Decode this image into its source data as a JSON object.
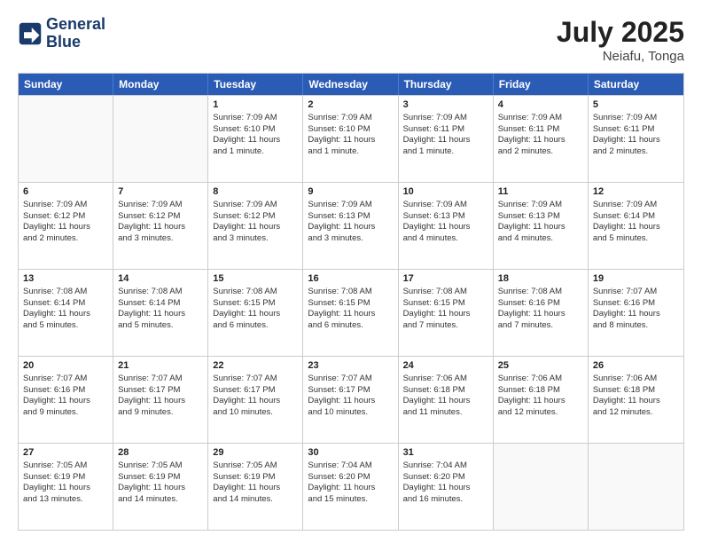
{
  "header": {
    "logo_line1": "General",
    "logo_line2": "Blue",
    "title": "July 2025",
    "subtitle": "Neiafu, Tonga"
  },
  "days": [
    "Sunday",
    "Monday",
    "Tuesday",
    "Wednesday",
    "Thursday",
    "Friday",
    "Saturday"
  ],
  "weeks": [
    [
      {
        "day": "",
        "empty": true
      },
      {
        "day": "",
        "empty": true
      },
      {
        "day": "1",
        "line1": "Sunrise: 7:09 AM",
        "line2": "Sunset: 6:10 PM",
        "line3": "Daylight: 11 hours",
        "line4": "and 1 minute."
      },
      {
        "day": "2",
        "line1": "Sunrise: 7:09 AM",
        "line2": "Sunset: 6:10 PM",
        "line3": "Daylight: 11 hours",
        "line4": "and 1 minute."
      },
      {
        "day": "3",
        "line1": "Sunrise: 7:09 AM",
        "line2": "Sunset: 6:11 PM",
        "line3": "Daylight: 11 hours",
        "line4": "and 1 minute."
      },
      {
        "day": "4",
        "line1": "Sunrise: 7:09 AM",
        "line2": "Sunset: 6:11 PM",
        "line3": "Daylight: 11 hours",
        "line4": "and 2 minutes."
      },
      {
        "day": "5",
        "line1": "Sunrise: 7:09 AM",
        "line2": "Sunset: 6:11 PM",
        "line3": "Daylight: 11 hours",
        "line4": "and 2 minutes."
      }
    ],
    [
      {
        "day": "6",
        "line1": "Sunrise: 7:09 AM",
        "line2": "Sunset: 6:12 PM",
        "line3": "Daylight: 11 hours",
        "line4": "and 2 minutes."
      },
      {
        "day": "7",
        "line1": "Sunrise: 7:09 AM",
        "line2": "Sunset: 6:12 PM",
        "line3": "Daylight: 11 hours",
        "line4": "and 3 minutes."
      },
      {
        "day": "8",
        "line1": "Sunrise: 7:09 AM",
        "line2": "Sunset: 6:12 PM",
        "line3": "Daylight: 11 hours",
        "line4": "and 3 minutes."
      },
      {
        "day": "9",
        "line1": "Sunrise: 7:09 AM",
        "line2": "Sunset: 6:13 PM",
        "line3": "Daylight: 11 hours",
        "line4": "and 3 minutes."
      },
      {
        "day": "10",
        "line1": "Sunrise: 7:09 AM",
        "line2": "Sunset: 6:13 PM",
        "line3": "Daylight: 11 hours",
        "line4": "and 4 minutes."
      },
      {
        "day": "11",
        "line1": "Sunrise: 7:09 AM",
        "line2": "Sunset: 6:13 PM",
        "line3": "Daylight: 11 hours",
        "line4": "and 4 minutes."
      },
      {
        "day": "12",
        "line1": "Sunrise: 7:09 AM",
        "line2": "Sunset: 6:14 PM",
        "line3": "Daylight: 11 hours",
        "line4": "and 5 minutes."
      }
    ],
    [
      {
        "day": "13",
        "line1": "Sunrise: 7:08 AM",
        "line2": "Sunset: 6:14 PM",
        "line3": "Daylight: 11 hours",
        "line4": "and 5 minutes."
      },
      {
        "day": "14",
        "line1": "Sunrise: 7:08 AM",
        "line2": "Sunset: 6:14 PM",
        "line3": "Daylight: 11 hours",
        "line4": "and 5 minutes."
      },
      {
        "day": "15",
        "line1": "Sunrise: 7:08 AM",
        "line2": "Sunset: 6:15 PM",
        "line3": "Daylight: 11 hours",
        "line4": "and 6 minutes."
      },
      {
        "day": "16",
        "line1": "Sunrise: 7:08 AM",
        "line2": "Sunset: 6:15 PM",
        "line3": "Daylight: 11 hours",
        "line4": "and 6 minutes."
      },
      {
        "day": "17",
        "line1": "Sunrise: 7:08 AM",
        "line2": "Sunset: 6:15 PM",
        "line3": "Daylight: 11 hours",
        "line4": "and 7 minutes."
      },
      {
        "day": "18",
        "line1": "Sunrise: 7:08 AM",
        "line2": "Sunset: 6:16 PM",
        "line3": "Daylight: 11 hours",
        "line4": "and 7 minutes."
      },
      {
        "day": "19",
        "line1": "Sunrise: 7:07 AM",
        "line2": "Sunset: 6:16 PM",
        "line3": "Daylight: 11 hours",
        "line4": "and 8 minutes."
      }
    ],
    [
      {
        "day": "20",
        "line1": "Sunrise: 7:07 AM",
        "line2": "Sunset: 6:16 PM",
        "line3": "Daylight: 11 hours",
        "line4": "and 9 minutes."
      },
      {
        "day": "21",
        "line1": "Sunrise: 7:07 AM",
        "line2": "Sunset: 6:17 PM",
        "line3": "Daylight: 11 hours",
        "line4": "and 9 minutes."
      },
      {
        "day": "22",
        "line1": "Sunrise: 7:07 AM",
        "line2": "Sunset: 6:17 PM",
        "line3": "Daylight: 11 hours",
        "line4": "and 10 minutes."
      },
      {
        "day": "23",
        "line1": "Sunrise: 7:07 AM",
        "line2": "Sunset: 6:17 PM",
        "line3": "Daylight: 11 hours",
        "line4": "and 10 minutes."
      },
      {
        "day": "24",
        "line1": "Sunrise: 7:06 AM",
        "line2": "Sunset: 6:18 PM",
        "line3": "Daylight: 11 hours",
        "line4": "and 11 minutes."
      },
      {
        "day": "25",
        "line1": "Sunrise: 7:06 AM",
        "line2": "Sunset: 6:18 PM",
        "line3": "Daylight: 11 hours",
        "line4": "and 12 minutes."
      },
      {
        "day": "26",
        "line1": "Sunrise: 7:06 AM",
        "line2": "Sunset: 6:18 PM",
        "line3": "Daylight: 11 hours",
        "line4": "and 12 minutes."
      }
    ],
    [
      {
        "day": "27",
        "line1": "Sunrise: 7:05 AM",
        "line2": "Sunset: 6:19 PM",
        "line3": "Daylight: 11 hours",
        "line4": "and 13 minutes."
      },
      {
        "day": "28",
        "line1": "Sunrise: 7:05 AM",
        "line2": "Sunset: 6:19 PM",
        "line3": "Daylight: 11 hours",
        "line4": "and 14 minutes."
      },
      {
        "day": "29",
        "line1": "Sunrise: 7:05 AM",
        "line2": "Sunset: 6:19 PM",
        "line3": "Daylight: 11 hours",
        "line4": "and 14 minutes."
      },
      {
        "day": "30",
        "line1": "Sunrise: 7:04 AM",
        "line2": "Sunset: 6:20 PM",
        "line3": "Daylight: 11 hours",
        "line4": "and 15 minutes."
      },
      {
        "day": "31",
        "line1": "Sunrise: 7:04 AM",
        "line2": "Sunset: 6:20 PM",
        "line3": "Daylight: 11 hours",
        "line4": "and 16 minutes."
      },
      {
        "day": "",
        "empty": true
      },
      {
        "day": "",
        "empty": true
      }
    ]
  ]
}
